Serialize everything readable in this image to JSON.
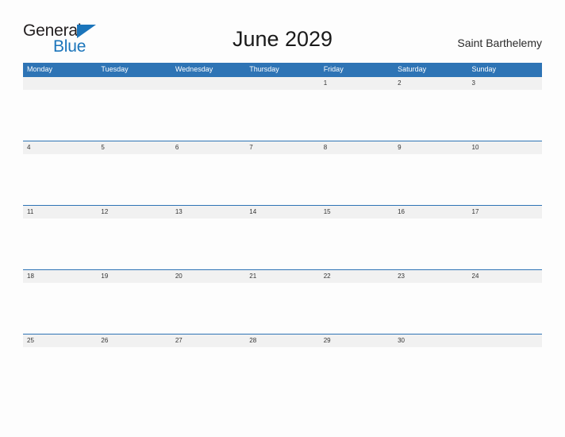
{
  "brand": {
    "name_top": "General",
    "name_bottom": "Blue",
    "flag_icon": "flag-triangle-icon",
    "accent_color": "#1b75bb"
  },
  "header": {
    "title": "June 2029",
    "location": "Saint Barthelemy"
  },
  "calendar": {
    "header_color": "#2e74b5",
    "band_color": "#f1f1f1",
    "weekdays": [
      "Monday",
      "Tuesday",
      "Wednesday",
      "Thursday",
      "Friday",
      "Saturday",
      "Sunday"
    ],
    "weeks": [
      [
        "",
        "",
        "",
        "",
        "1",
        "2",
        "3"
      ],
      [
        "4",
        "5",
        "6",
        "7",
        "8",
        "9",
        "10"
      ],
      [
        "11",
        "12",
        "13",
        "14",
        "15",
        "16",
        "17"
      ],
      [
        "18",
        "19",
        "20",
        "21",
        "22",
        "23",
        "24"
      ],
      [
        "25",
        "26",
        "27",
        "28",
        "29",
        "30",
        ""
      ]
    ]
  }
}
